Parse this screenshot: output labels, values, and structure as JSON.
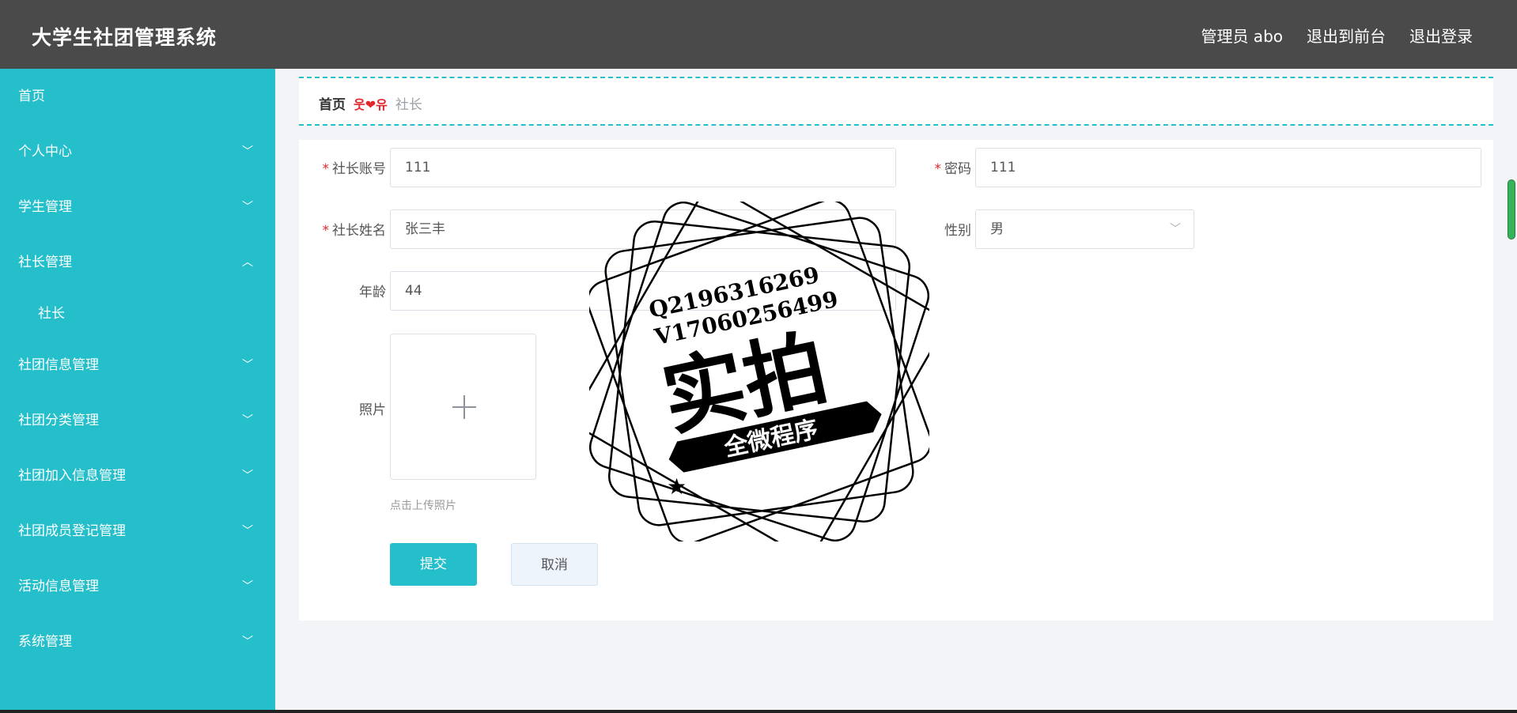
{
  "header": {
    "title": "大学生社团管理系统",
    "user_label": "管理员 abo",
    "front_link": "退出到前台",
    "logout_link": "退出登录"
  },
  "sidebar": {
    "items": [
      {
        "label": "首页",
        "has_children": false
      },
      {
        "label": "个人中心",
        "has_children": true,
        "expanded": false
      },
      {
        "label": "学生管理",
        "has_children": true,
        "expanded": false
      },
      {
        "label": "社长管理",
        "has_children": true,
        "expanded": true,
        "children": [
          "社长"
        ]
      },
      {
        "label": "社团信息管理",
        "has_children": true,
        "expanded": false
      },
      {
        "label": "社团分类管理",
        "has_children": true,
        "expanded": false
      },
      {
        "label": "社团加入信息管理",
        "has_children": true,
        "expanded": false
      },
      {
        "label": "社团成员登记管理",
        "has_children": true,
        "expanded": false
      },
      {
        "label": "活动信息管理",
        "has_children": true,
        "expanded": false
      },
      {
        "label": "系统管理",
        "has_children": true,
        "expanded": false
      }
    ]
  },
  "breadcrumb": {
    "home": "首页",
    "separator": "웃❤유",
    "current": "社长"
  },
  "form": {
    "account_label": "社长账号",
    "account_value": "111",
    "password_label": "密码",
    "password_value": "111",
    "name_label": "社长姓名",
    "name_value": "张三丰",
    "gender_label": "性别",
    "gender_value": "男",
    "age_label": "年龄",
    "age_value": "44",
    "photo_label": "照片",
    "upload_hint": "点击上传照片",
    "submit_label": "提交",
    "cancel_label": "取消"
  },
  "watermark": {
    "line1": "Q2196316269",
    "line2": "V17060256499",
    "main_text": "实拍",
    "ribbon_text": "全微程序"
  },
  "colors": {
    "topbar": "#4a4a4a",
    "sidebar": "#24bfcb",
    "accent": "#24bfcb",
    "required": "#e3262b"
  }
}
